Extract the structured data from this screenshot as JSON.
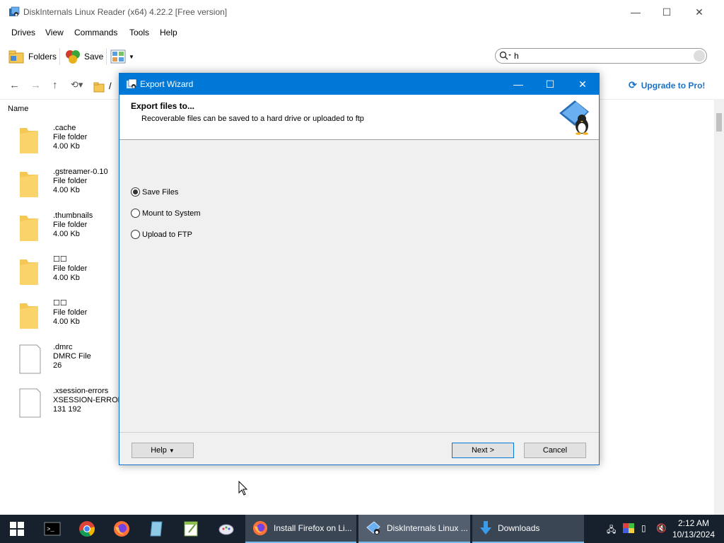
{
  "window": {
    "title": "DiskInternals Linux Reader (x64) 4.22.2 [Free version]",
    "minimize": "—",
    "maximize": "☐",
    "close": "✕"
  },
  "menu": [
    "Drives",
    "View",
    "Commands",
    "Tools",
    "Help"
  ],
  "toolbar": {
    "folders_label": "Folders",
    "save_label": "Save"
  },
  "search": {
    "value": "h"
  },
  "nav": {
    "path": "/",
    "upgrade_label": "Upgrade to Pro!"
  },
  "list": {
    "column_name": "Name",
    "files": [
      {
        "name": ".cache",
        "type": "File folder",
        "size": "4.00 Kb",
        "kind": "folder"
      },
      {
        "name": ".gstreamer-0.10",
        "type": "File folder",
        "size": "4.00 Kb",
        "kind": "folder"
      },
      {
        "name": ".thumbnails",
        "type": "File folder",
        "size": "4.00 Kb",
        "kind": "folder"
      },
      {
        "name": "☐☐",
        "type": "File folder",
        "size": "4.00 Kb",
        "kind": "folder"
      },
      {
        "name": "☐☐",
        "type": "File folder",
        "size": "4.00 Kb",
        "kind": "folder"
      },
      {
        "name": ".dmrc",
        "type": "DMRC File",
        "size": "26",
        "kind": "file"
      },
      {
        "name": ".xsession-errors",
        "type": "XSESSION-ERRORS",
        "size": "131 192",
        "kind": "file"
      }
    ]
  },
  "dialog": {
    "title": "Export Wizard",
    "heading": "Export files to...",
    "subheading": "Recoverable files can be saved to a hard drive or uploaded to ftp",
    "options": [
      {
        "label": "Save Files",
        "selected": true
      },
      {
        "label": "Mount to System",
        "selected": false
      },
      {
        "label": "Upload to FTP",
        "selected": false
      }
    ],
    "help_label": "Help",
    "next_label": "Next >",
    "cancel_label": "Cancel"
  },
  "taskbar": {
    "tasks": [
      {
        "label": "Install Firefox on Li...",
        "icon": "firefox-icon"
      },
      {
        "label": "DiskInternals Linux ...",
        "icon": "linux-reader-icon"
      },
      {
        "label": "Downloads",
        "icon": "download-arrow-icon"
      }
    ],
    "time": "2:12 AM",
    "date": "10/13/2024"
  },
  "colors": {
    "accent": "#0078d7",
    "taskbar": "#17212e",
    "folder": "#f5c755"
  }
}
